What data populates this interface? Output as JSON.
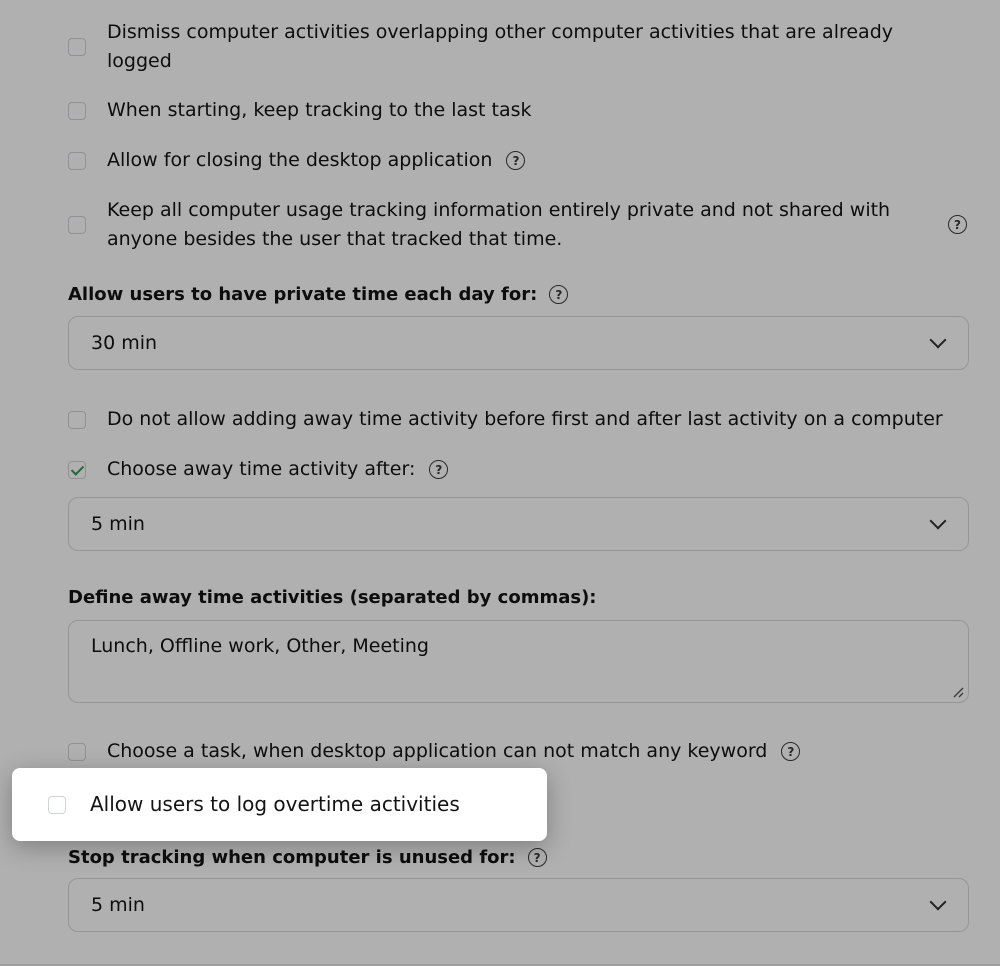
{
  "options": {
    "dismiss_overlapping": {
      "label": "Dismiss computer activities overlapping other computer activities that are already logged",
      "checked": false
    },
    "keep_tracking_last_task": {
      "label": "When starting, keep tracking to the last task",
      "checked": false
    },
    "allow_closing_app": {
      "label": "Allow for closing the desktop application",
      "checked": false
    },
    "keep_private": {
      "label": "Keep all computer usage tracking information entirely private and not shared with anyone besides the user that tracked that time.",
      "checked": false
    },
    "no_away_before_after": {
      "label": "Do not allow adding away time activity before first and after last activity on a computer",
      "checked": false
    },
    "choose_away_after": {
      "label": "Choose away time activity after:",
      "checked": true
    },
    "choose_task_no_keyword": {
      "label": "Choose a task, when desktop application can not match any keyword",
      "checked": false
    },
    "allow_overtime": {
      "label": "Allow users to log overtime activities",
      "checked": false
    }
  },
  "private_time": {
    "label": "Allow users to have private time each day for:",
    "value": "30 min"
  },
  "away_time": {
    "value": "5 min"
  },
  "away_activities": {
    "label": "Define away time activities (separated by commas):",
    "value": "Lunch, Offline work, Other, Meeting"
  },
  "stop_tracking": {
    "label": "Stop tracking when computer is unused for:",
    "value": "5 min"
  },
  "help_glyph": "?",
  "colors": {
    "check_accent": "#2e9a55",
    "overlay": "rgba(0,0,0,0.31)"
  }
}
